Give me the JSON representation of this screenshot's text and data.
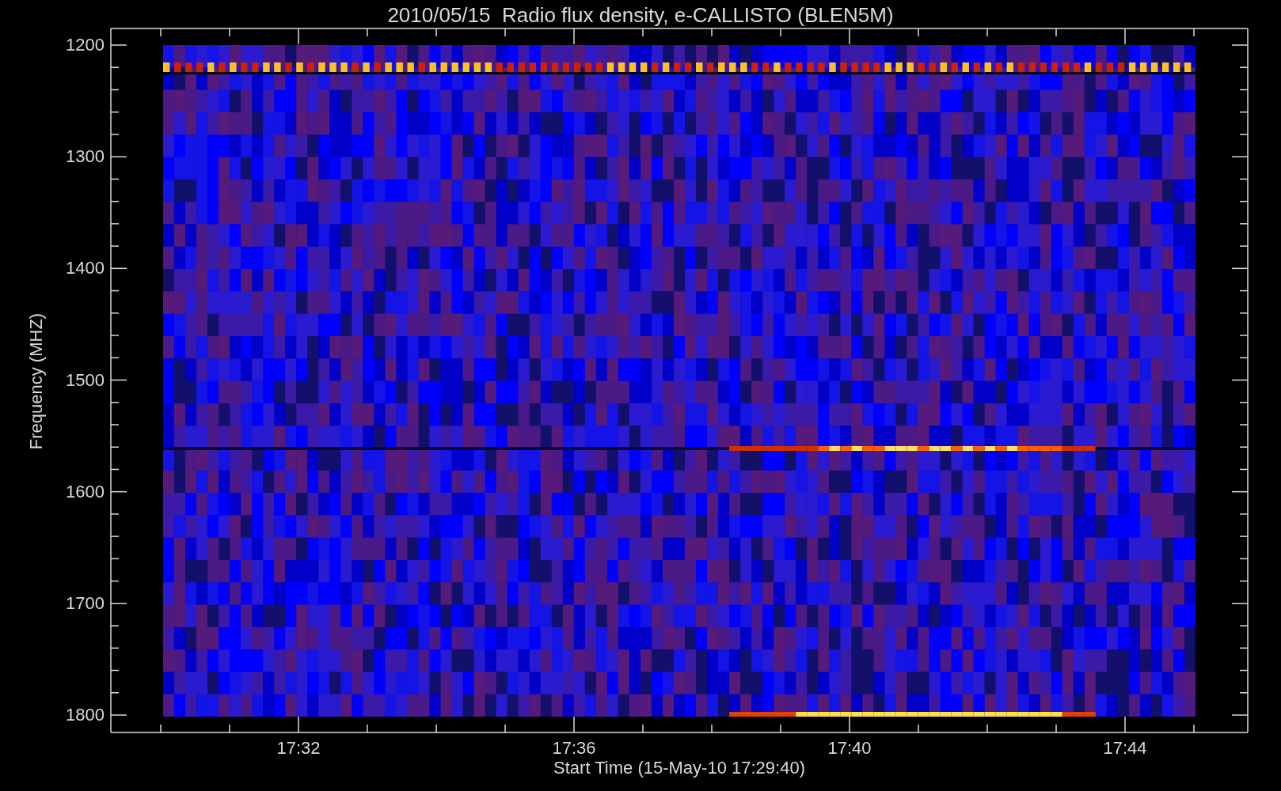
{
  "plot": {
    "title": "2010/05/15  Radio flux density, e-CALLISTO (BLEN5M)",
    "ylabel": "Frequency (MHZ)",
    "xlabel": "Start Time (15-May-10 17:29:40)",
    "yticks": [
      "1200",
      "1300",
      "1400",
      "1500",
      "1600",
      "1700",
      "1800"
    ],
    "xticks": [
      "17:32",
      "17:36",
      "17:40",
      "17:44"
    ]
  }
}
